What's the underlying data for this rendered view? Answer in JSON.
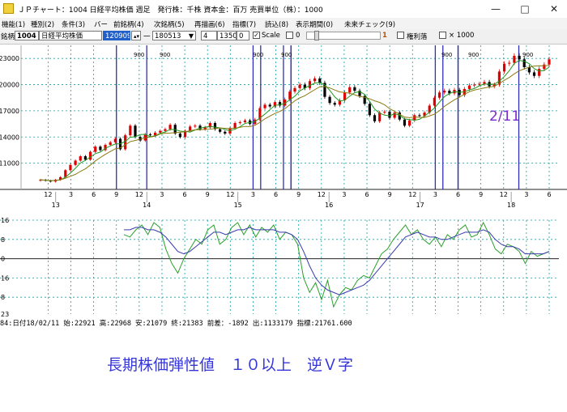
{
  "titlebar": {
    "title": "ＪＰチャート：1004 日経平均株価 週足　発行株：千株 資本金：百万 売買単位（株）：1000",
    "minimize": "—",
    "maximize": "□",
    "close": "✕"
  },
  "menu": {
    "items": [
      "機能(1)",
      "種別(2)",
      "条件(3)",
      "バー",
      "前銘柄(4)",
      "次銘柄(5)",
      "再描画(6)",
      "指標(7)",
      "読込(8)",
      "表示期間(0)",
      "未来チェック(9)"
    ]
  },
  "toolbar": {
    "code_label": "銘柄",
    "code": "1004",
    "name": "日経平均株価",
    "selected_value": "120909",
    "dash": "一",
    "end_date": "180513",
    "period": "4",
    "width": "1350",
    "offset": "0",
    "scale_label": "Scale",
    "zero_value": "0",
    "rights_label": "権利落",
    "multiplier_label": "× 1000",
    "marker": "1"
  },
  "price_axis": {
    "labels": [
      "23000",
      "20000",
      "17000",
      "14000",
      "11000"
    ]
  },
  "date_axis": {
    "months": [
      "12",
      "3",
      "6",
      "9",
      "12",
      "3",
      "6",
      "9",
      "12",
      "3",
      "6",
      "9",
      "12",
      "3",
      "6",
      "9",
      "12",
      "3",
      "6",
      "9",
      "12",
      "3",
      "6"
    ],
    "years": [
      "13",
      "14",
      "15",
      "16",
      "17",
      "18"
    ]
  },
  "osc_axis": {
    "labels": [
      "16",
      "8",
      "0",
      "16",
      "8",
      "23"
    ]
  },
  "signal_labels": [
    "900",
    "900",
    "900",
    "900",
    "900",
    "900",
    "900"
  ],
  "annotation": "2/11",
  "status": "84:日付18/02/11 始:22921 高:22968 安:21079 終:21383 前差：-1892 出:1133179 指標:21761.600",
  "caption": "長期株価弾性値　１０以上　逆Ｖ字",
  "colors": {
    "up": "#e00000",
    "down": "#000000",
    "ma_short": "#1f9a1f",
    "ma_long": "#8a7a10",
    "signal": "#2f2fb8",
    "grid": "#14a0a0",
    "osc_fast": "#2aa02a",
    "osc_slow": "#3a3ab0",
    "caption": "#3535d8",
    "annotation": "#7b2ad0"
  },
  "chart_data": [
    {
      "type": "candlestick",
      "title": "",
      "xlabel": "",
      "ylabel": "",
      "ylim": [
        8000,
        24500
      ],
      "x_range": [
        "2012-11",
        "2018-06"
      ],
      "ma_periods": [
        "short",
        "long"
      ],
      "values": [
        9100,
        9000,
        8900,
        9100,
        9400,
        10200,
        10800,
        11300,
        11800,
        11400,
        12300,
        12900,
        12500,
        13100,
        13400,
        13800,
        12600,
        14200,
        15300,
        14000,
        13600,
        14300,
        14200,
        14500,
        14700,
        14900,
        15400,
        14400,
        14000,
        14700,
        15200,
        15300,
        14900,
        15100,
        15600,
        14900,
        14600,
        14400,
        15000,
        15600,
        15700,
        15900,
        15500,
        16000,
        17300,
        17700,
        17500,
        18000,
        17600,
        18300,
        19200,
        19600,
        20000,
        19600,
        20400,
        20700,
        20200,
        18600,
        17900,
        17700,
        18200,
        19100,
        19700,
        19300,
        18700,
        17800,
        16500,
        15800,
        16800,
        16900,
        16200,
        16800,
        16000,
        15300,
        15900,
        16500,
        16400,
        16800,
        17600,
        18500,
        19100,
        19300,
        19000,
        19400,
        18800,
        19500,
        19900,
        20000,
        20100,
        20300,
        19800,
        20000,
        21500,
        22400,
        22500,
        23300,
        22900,
        22000,
        21400,
        21000,
        21800,
        22300,
        22900
      ],
      "signals": [
        "2013-09",
        "2014-01",
        "2015-03",
        "2015-04",
        "2015-07",
        "2015-08",
        "2015-08",
        "2017-03",
        "2017-04",
        "2017-06",
        "2017-06",
        "2018-02"
      ]
    },
    {
      "type": "line",
      "title": "",
      "ylim": [
        -23,
        16
      ],
      "series": [
        {
          "color_key": "osc_fast",
          "values": [
            10,
            9,
            12,
            14,
            10,
            15,
            13,
            4,
            -2,
            -6,
            0,
            4,
            8,
            6,
            12,
            14,
            6,
            8,
            13,
            15,
            10,
            14,
            9,
            13,
            11,
            14,
            8,
            11,
            10,
            6,
            -8,
            -14,
            -10,
            -17,
            -9,
            -20,
            -15,
            -12,
            -13,
            -9,
            -7,
            -8,
            -3,
            2,
            4,
            8,
            11,
            14,
            10,
            12,
            8,
            6,
            9,
            5,
            10,
            8,
            12,
            14,
            9,
            10,
            15,
            10,
            4,
            2,
            6,
            5,
            3,
            -2,
            3,
            1,
            2,
            3
          ]
        },
        {
          "color_key": "osc_slow",
          "values": [
            12,
            12,
            13,
            13,
            12,
            12,
            11,
            9,
            6,
            3,
            2,
            3,
            5,
            7,
            9,
            11,
            11,
            10,
            11,
            12,
            12,
            13,
            12,
            12,
            12,
            12,
            11,
            11,
            10,
            8,
            3,
            -3,
            -8,
            -11,
            -13,
            -14,
            -15,
            -14,
            -13,
            -12,
            -11,
            -9,
            -6,
            -3,
            0,
            3,
            6,
            9,
            10,
            11,
            10,
            9,
            9,
            8,
            8,
            9,
            10,
            11,
            11,
            11,
            12,
            11,
            8,
            6,
            5,
            5,
            4,
            2,
            2,
            2,
            2,
            3
          ]
        }
      ]
    }
  ]
}
